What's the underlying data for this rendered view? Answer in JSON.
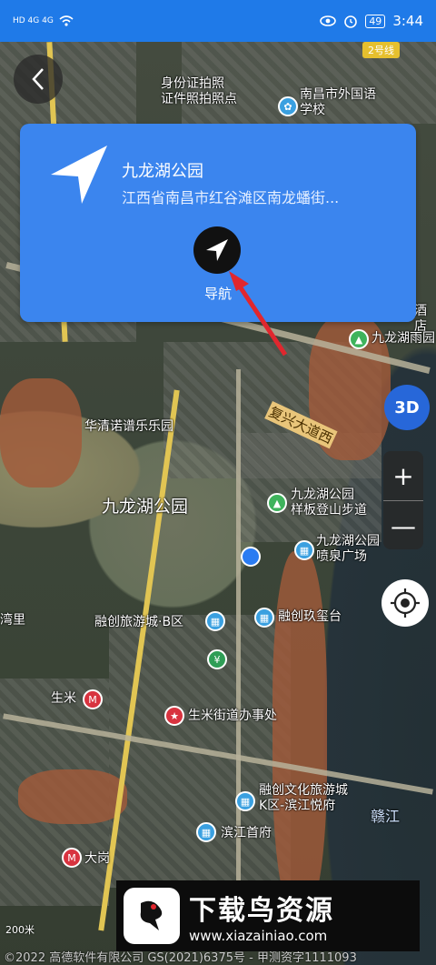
{
  "status_bar": {
    "signal_text": "HD 4G 4G",
    "battery": "49",
    "time": "3:44"
  },
  "place": {
    "name": "九龙湖公园",
    "address": "江西省南昌市红谷滩区南龙蟠街..."
  },
  "actions": {
    "navigate_label": "导航",
    "three_d_label": "3D",
    "zoom_in": "+",
    "zoom_out": "—"
  },
  "map": {
    "metro_badge": "2号线",
    "lake_label": "九龙湖公园",
    "road_label": "复兴大道西",
    "river_label": "赣江",
    "scale": "200米",
    "copyright": "©2022 高德软件有限公司 GS(2021)6375号 - 甲测资字1111093",
    "pois": [
      {
        "label": "身份证拍照\n证件照拍照点"
      },
      {
        "label": "南昌市外国语\n学校"
      },
      {
        "label": "酒店"
      },
      {
        "label": "九龙湖雨园"
      },
      {
        "label": "华清诺谱乐乐园"
      },
      {
        "label": "九龙湖公园\n样板登山步道"
      },
      {
        "label": "九龙湖公园\n喷泉广场"
      },
      {
        "label": "融创玖玺台"
      },
      {
        "label": "融创旅游城·B区"
      },
      {
        "label": "生米"
      },
      {
        "label": "生米街道办事处"
      },
      {
        "label": "融创文化旅游城\nK区-滨江悦府"
      },
      {
        "label": "滨江首府"
      },
      {
        "label": "大岗"
      },
      {
        "label": "湾里"
      }
    ]
  },
  "watermark": {
    "title": "下载鸟资源",
    "url": "www.xiazainiao.com"
  },
  "colors": {
    "accent": "#3b85ee",
    "status_bar": "#1f7ae8",
    "annotation": "#e0272e"
  }
}
